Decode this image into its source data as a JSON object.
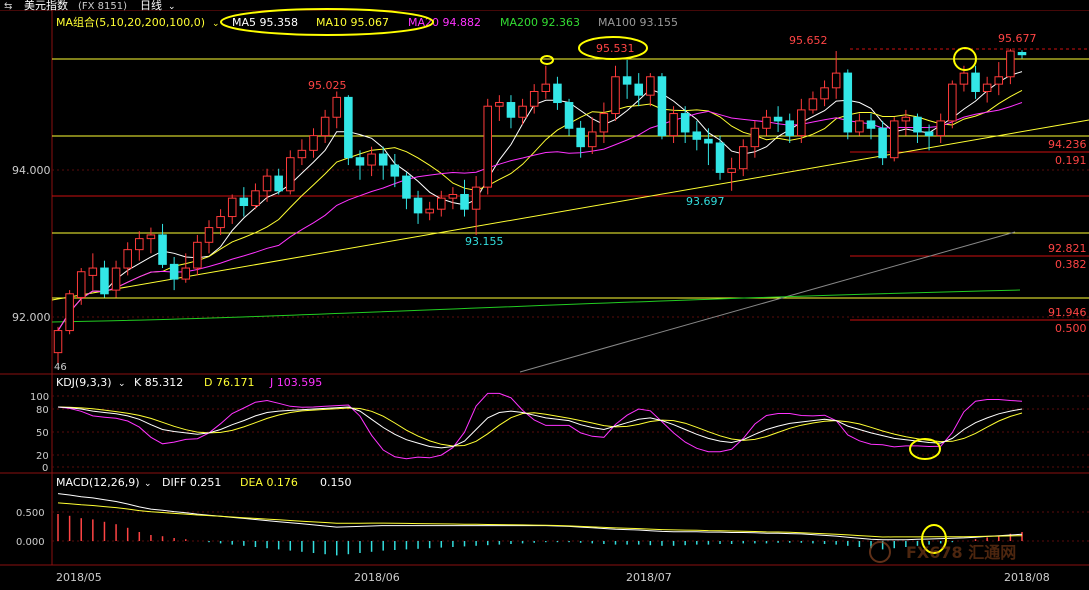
{
  "header": {
    "title": "美元指数",
    "code": "(FX 8151)",
    "period": "日线"
  },
  "ma_row": {
    "label": "MA组合(5,10,20,200,100,0)",
    "items": [
      {
        "name": "MA5",
        "value": "95.358",
        "color": "#ffffff"
      },
      {
        "name": "MA10",
        "value": "95.067",
        "color": "#ffff33"
      },
      {
        "name": "MA20",
        "value": "94.882",
        "color": "#ff33ff"
      },
      {
        "name": "MA200",
        "value": "92.363",
        "color": "#33dd33"
      },
      {
        "name": "MA100",
        "value": "93.155",
        "color": "#999999"
      }
    ]
  },
  "price_axis": [
    "94.000",
    "92.000"
  ],
  "price_annotations": {
    "p95025": "95.025",
    "p95531": "95.531",
    "p95652": "95.652",
    "p95677": "95.677",
    "p93697": "93.697",
    "p93155": "93.155",
    "fib1_value": "94.236",
    "fib1_ratio": "0.191",
    "fib2_value": "92.821",
    "fib2_ratio": "0.382",
    "fib3_value": "91.946",
    "fib3_ratio": "0.500",
    "low_marker": "46"
  },
  "kdj": {
    "label": "KDJ(9,3,3)",
    "k": "K 85.312",
    "d": "D 76.171",
    "j": "J 103.595",
    "axis": [
      "100",
      "80",
      "50",
      "20",
      "0"
    ]
  },
  "macd": {
    "label": "MACD(12,26,9)",
    "diff": "DIFF 0.251",
    "dea": "DEA 0.176",
    "macd": "0.150",
    "axis": [
      "0.500",
      "0.000"
    ]
  },
  "dates": [
    "2018/05",
    "2018/06",
    "2018/07",
    "2018/08"
  ],
  "watermark": "FX678 汇通网",
  "chart_data": {
    "type": "candlestick",
    "title": "美元指数 (FX 8151) 日线",
    "ylim": [
      91.45,
      95.8
    ],
    "candles": [
      [
        91.55,
        91.85,
        91.4,
        91.9
      ],
      [
        91.85,
        92.35,
        91.8,
        92.4
      ],
      [
        92.3,
        92.65,
        92.2,
        92.7
      ],
      [
        92.6,
        92.7,
        92.4,
        92.9
      ],
      [
        92.7,
        92.35,
        92.3,
        92.8
      ],
      [
        92.4,
        92.7,
        92.3,
        92.8
      ],
      [
        92.7,
        92.95,
        92.6,
        93.05
      ],
      [
        92.95,
        93.1,
        92.8,
        93.2
      ],
      [
        93.1,
        93.15,
        92.9,
        93.25
      ],
      [
        93.15,
        92.75,
        92.7,
        93.3
      ],
      [
        92.75,
        92.55,
        92.4,
        92.85
      ],
      [
        92.55,
        92.7,
        92.5,
        92.9
      ],
      [
        92.7,
        93.05,
        92.6,
        93.15
      ],
      [
        93.05,
        93.25,
        92.9,
        93.35
      ],
      [
        93.25,
        93.4,
        93.15,
        93.5
      ],
      [
        93.4,
        93.65,
        93.3,
        93.7
      ],
      [
        93.65,
        93.55,
        93.4,
        93.8
      ],
      [
        93.55,
        93.75,
        93.5,
        93.85
      ],
      [
        93.75,
        93.95,
        93.6,
        94.05
      ],
      [
        93.95,
        93.75,
        93.7,
        94.05
      ],
      [
        93.75,
        94.2,
        93.7,
        94.3
      ],
      [
        94.2,
        94.3,
        94.1,
        94.45
      ],
      [
        94.3,
        94.5,
        94.2,
        94.6
      ],
      [
        94.5,
        94.75,
        94.4,
        94.85
      ],
      [
        94.75,
        95.02,
        94.6,
        95.1
      ],
      [
        95.02,
        94.2,
        94.1,
        95.05
      ],
      [
        94.2,
        94.1,
        93.9,
        94.3
      ],
      [
        94.1,
        94.25,
        93.95,
        94.35
      ],
      [
        94.25,
        94.1,
        93.9,
        94.35
      ],
      [
        94.1,
        93.95,
        93.8,
        94.25
      ],
      [
        93.95,
        93.65,
        93.5,
        94.0
      ],
      [
        93.65,
        93.45,
        93.3,
        93.75
      ],
      [
        93.45,
        93.5,
        93.35,
        93.6
      ],
      [
        93.5,
        93.65,
        93.4,
        93.75
      ],
      [
        93.65,
        93.7,
        93.5,
        93.8
      ],
      [
        93.7,
        93.5,
        93.4,
        93.9
      ],
      [
        93.5,
        93.8,
        93.15,
        93.95
      ],
      [
        93.8,
        94.9,
        93.7,
        95.0
      ],
      [
        94.9,
        94.95,
        94.7,
        95.05
      ],
      [
        94.95,
        94.75,
        94.6,
        95.05
      ],
      [
        94.75,
        94.9,
        94.65,
        95.0
      ],
      [
        94.9,
        95.1,
        94.8,
        95.2
      ],
      [
        95.1,
        95.2,
        95.0,
        95.45
      ],
      [
        95.2,
        94.95,
        94.85,
        95.3
      ],
      [
        94.95,
        94.6,
        94.5,
        95.0
      ],
      [
        94.6,
        94.35,
        94.2,
        94.7
      ],
      [
        94.35,
        94.55,
        94.25,
        94.75
      ],
      [
        94.55,
        94.8,
        94.4,
        94.95
      ],
      [
        94.8,
        95.3,
        94.7,
        95.45
      ],
      [
        95.3,
        95.2,
        95.0,
        95.53
      ],
      [
        95.2,
        95.05,
        94.9,
        95.35
      ],
      [
        95.05,
        95.3,
        94.9,
        95.35
      ],
      [
        95.3,
        94.5,
        94.45,
        95.35
      ],
      [
        94.5,
        94.8,
        94.4,
        94.9
      ],
      [
        94.8,
        94.55,
        94.4,
        94.9
      ],
      [
        94.55,
        94.45,
        94.3,
        94.7
      ],
      [
        94.45,
        94.4,
        94.1,
        94.6
      ],
      [
        94.4,
        94.0,
        93.9,
        94.5
      ],
      [
        94.0,
        94.05,
        93.75,
        94.2
      ],
      [
        94.05,
        94.35,
        93.95,
        94.45
      ],
      [
        94.35,
        94.6,
        94.2,
        94.7
      ],
      [
        94.6,
        94.75,
        94.5,
        94.85
      ],
      [
        94.75,
        94.7,
        94.55,
        94.9
      ],
      [
        94.7,
        94.5,
        94.4,
        94.8
      ],
      [
        94.5,
        94.85,
        94.4,
        95.0
      ],
      [
        94.85,
        95.0,
        94.8,
        95.1
      ],
      [
        95.0,
        95.15,
        94.9,
        95.25
      ],
      [
        95.15,
        95.35,
        95.0,
        95.65
      ],
      [
        95.35,
        94.55,
        94.45,
        95.4
      ],
      [
        94.55,
        94.7,
        94.5,
        94.8
      ],
      [
        94.7,
        94.6,
        94.45,
        94.8
      ],
      [
        94.6,
        94.2,
        94.1,
        94.7
      ],
      [
        94.2,
        94.7,
        94.15,
        94.75
      ],
      [
        94.7,
        94.75,
        94.5,
        94.85
      ],
      [
        94.75,
        94.55,
        94.4,
        94.8
      ],
      [
        94.55,
        94.5,
        94.3,
        94.65
      ],
      [
        94.5,
        94.7,
        94.4,
        94.8
      ],
      [
        94.7,
        95.2,
        94.6,
        95.25
      ],
      [
        95.2,
        95.35,
        95.1,
        95.45
      ],
      [
        95.35,
        95.1,
        95.0,
        95.45
      ],
      [
        95.1,
        95.2,
        94.95,
        95.3
      ],
      [
        95.2,
        95.3,
        95.05,
        95.5
      ],
      [
        95.3,
        95.65,
        95.2,
        95.68
      ],
      [
        95.63,
        95.6,
        95.55,
        95.66
      ]
    ],
    "levels": {
      "fib_0191": 94.236,
      "fib_0382": 92.821,
      "fib_0500": 91.946,
      "high": 95.677,
      "mid_high": 95.025,
      "low_a": 93.697,
      "low_b": 93.155
    },
    "kdj_k": [
      88,
      87,
      85,
      82,
      80,
      78,
      75,
      70,
      62,
      55,
      52,
      50,
      48,
      50,
      55,
      62,
      68,
      75,
      80,
      82,
      83,
      84,
      85,
      86,
      87,
      88,
      82,
      70,
      58,
      48,
      40,
      35,
      30,
      28,
      30,
      38,
      55,
      72,
      80,
      82,
      80,
      76,
      72,
      70,
      68,
      62,
      58,
      55,
      60,
      65,
      70,
      72,
      68,
      62,
      55,
      48,
      42,
      38,
      36,
      40,
      48,
      55,
      60,
      64,
      66,
      68,
      70,
      68,
      60,
      55,
      50,
      46,
      42,
      40,
      38,
      36,
      35,
      42,
      55,
      65,
      72,
      78,
      82,
      85
    ],
    "macd_hist": [
      0.45,
      0.42,
      0.38,
      0.36,
      0.32,
      0.28,
      0.22,
      0.15,
      0.1,
      0.08,
      0.05,
      0.03,
      0.0,
      -0.02,
      -0.04,
      -0.06,
      -0.08,
      -0.1,
      -0.12,
      -0.14,
      -0.16,
      -0.18,
      -0.2,
      -0.22,
      -0.24,
      -0.22,
      -0.2,
      -0.18,
      -0.16,
      -0.15,
      -0.14,
      -0.13,
      -0.12,
      -0.11,
      -0.1,
      -0.09,
      -0.08,
      -0.07,
      -0.06,
      -0.05,
      -0.04,
      -0.03,
      -0.02,
      -0.02,
      -0.02,
      -0.03,
      -0.04,
      -0.05,
      -0.06,
      -0.06,
      -0.06,
      -0.07,
      -0.08,
      -0.08,
      -0.07,
      -0.06,
      -0.06,
      -0.05,
      -0.05,
      -0.04,
      -0.04,
      -0.04,
      -0.03,
      -0.03,
      -0.03,
      -0.04,
      -0.05,
      -0.06,
      -0.08,
      -0.1,
      -0.12,
      -0.14,
      -0.12,
      -0.1,
      -0.08,
      -0.06,
      -0.04,
      -0.02,
      0.0,
      0.03,
      0.06,
      0.09,
      0.12,
      0.15
    ]
  }
}
